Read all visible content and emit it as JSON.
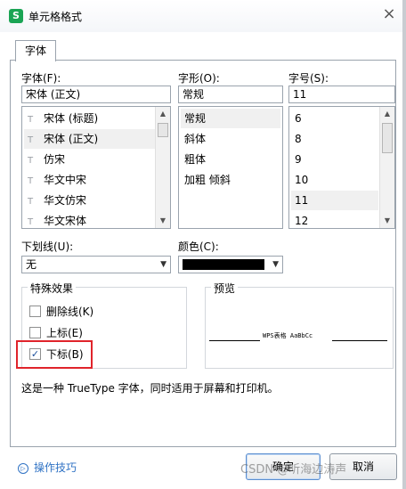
{
  "window": {
    "title": "单元格格式",
    "app_icon_letter": "S",
    "close_label": "×"
  },
  "tabs": [
    {
      "label": "字体"
    }
  ],
  "font": {
    "label": "字体(F):",
    "value": "宋体 (正文)",
    "items": [
      {
        "label": "宋体 (标题)"
      },
      {
        "label": "宋体 (正文)"
      },
      {
        "label": "仿宋"
      },
      {
        "label": "华文中宋"
      },
      {
        "label": "华文仿宋"
      },
      {
        "label": "华文宋体"
      }
    ],
    "selected_index": 1
  },
  "style": {
    "label": "字形(O):",
    "value": "常规",
    "items": [
      {
        "label": "常规"
      },
      {
        "label": "斜体"
      },
      {
        "label": "粗体"
      },
      {
        "label": "加粗 倾斜"
      }
    ],
    "selected_index": 0
  },
  "size": {
    "label": "字号(S):",
    "value": "11",
    "items": [
      {
        "label": "6"
      },
      {
        "label": "8"
      },
      {
        "label": "9"
      },
      {
        "label": "10"
      },
      {
        "label": "11"
      },
      {
        "label": "12"
      }
    ],
    "selected_index": 4
  },
  "underline": {
    "label": "下划线(U):",
    "value": "无"
  },
  "color": {
    "label": "颜色(C):",
    "value": "#000000"
  },
  "effects": {
    "title": "特殊效果",
    "items": [
      {
        "label": "删除线(K)",
        "checked": false
      },
      {
        "label": "上标(E)",
        "checked": false
      },
      {
        "label": "下标(B)",
        "checked": true
      }
    ],
    "check_mark": "✓"
  },
  "preview": {
    "title": "预览",
    "sample": "WPS表格  AaBbCc"
  },
  "description": "这是一种 TrueType 字体，同时适用于屏幕和打印机。",
  "footer": {
    "tips_label": "操作技巧",
    "ok_label": "确定",
    "cancel_label": "取消",
    "watermark": "CSDN @听海边涛声"
  },
  "icons": {
    "truetype": "T",
    "scroll_up": "▲",
    "scroll_down": "▼",
    "dropdown": "▼",
    "tips": "▷"
  },
  "colors": {
    "accent": "#2f72c4",
    "highlight": "#e0242b",
    "app": "#1aa454"
  }
}
